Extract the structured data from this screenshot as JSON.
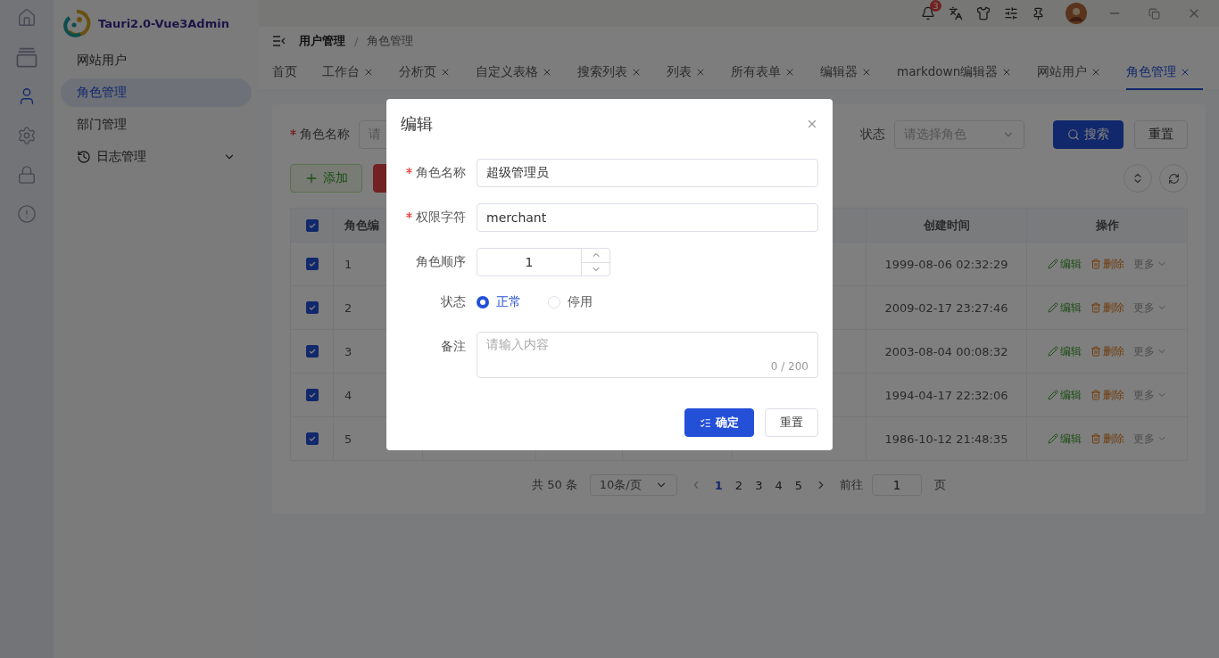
{
  "rail": {
    "items": [
      {
        "selected": false
      },
      {
        "selected": false
      },
      {
        "selected": true
      },
      {
        "selected": false
      },
      {
        "selected": false
      },
      {
        "selected": false
      }
    ]
  },
  "app_title": "Tauri2.0-Vue3Admin",
  "sidebar": {
    "items": [
      {
        "kind": "item",
        "label": "网站用户",
        "selected": false
      },
      {
        "kind": "item",
        "label": "角色管理",
        "selected": true
      },
      {
        "kind": "item",
        "label": "部门管理",
        "selected": false
      },
      {
        "kind": "group",
        "label": "日志管理",
        "selected": false,
        "expanded": false
      }
    ]
  },
  "topbar": {
    "notification_count": "3"
  },
  "breadcrumb": {
    "items": [
      "用户管理",
      "角色管理"
    ],
    "separator": "/"
  },
  "tabs": [
    {
      "label": "首页",
      "closable": false,
      "selected": false
    },
    {
      "label": "工作台",
      "closable": true,
      "selected": false
    },
    {
      "label": "分析页",
      "closable": true,
      "selected": false
    },
    {
      "label": "自定义表格",
      "closable": true,
      "selected": false
    },
    {
      "label": "搜索列表",
      "closable": true,
      "selected": false
    },
    {
      "label": "列表",
      "closable": true,
      "selected": false
    },
    {
      "label": "所有表单",
      "closable": true,
      "selected": false
    },
    {
      "label": "编辑器",
      "closable": true,
      "selected": false
    },
    {
      "label": "markdown编辑器",
      "closable": true,
      "selected": false
    },
    {
      "label": "网站用户",
      "closable": true,
      "selected": false
    },
    {
      "label": "角色管理",
      "closable": true,
      "selected": true
    }
  ],
  "search_form": {
    "name_field": {
      "label": "角色名称",
      "required": true,
      "placeholder": "请"
    },
    "status_field": {
      "label": "状态",
      "placeholder": "请选择角色"
    },
    "buttons": [
      {
        "label": "搜索",
        "kind": "primary"
      },
      {
        "label": "重置",
        "kind": "default"
      }
    ]
  },
  "toolbar": {
    "buttons": [
      {
        "label": "添加",
        "kind": "add"
      },
      {
        "kind": "delete"
      }
    ]
  },
  "table": {
    "select_all": true,
    "id_label": "角色编",
    "created_label": "创建时间",
    "actions_label": "操作",
    "rows": [
      {
        "checked": true,
        "id": "1",
        "created": "1999-08-06 02:32:29",
        "actions": [
          {
            "label": "编辑",
            "kind": "edit"
          },
          {
            "label": "删除",
            "kind": "delete"
          },
          {
            "label": "更多",
            "kind": "more"
          }
        ]
      },
      {
        "checked": true,
        "id": "2",
        "created": "2009-02-17 23:27:46",
        "actions": [
          {
            "label": "编辑",
            "kind": "edit"
          },
          {
            "label": "删除",
            "kind": "delete"
          },
          {
            "label": "更多",
            "kind": "more"
          }
        ]
      },
      {
        "checked": true,
        "id": "3",
        "created": "2003-08-04 00:08:32",
        "actions": [
          {
            "label": "编辑",
            "kind": "edit"
          },
          {
            "label": "删除",
            "kind": "delete"
          },
          {
            "label": "更多",
            "kind": "more"
          }
        ]
      },
      {
        "checked": true,
        "id": "4",
        "created": "1994-04-17 22:32:06",
        "actions": [
          {
            "label": "编辑",
            "kind": "edit"
          },
          {
            "label": "删除",
            "kind": "delete"
          },
          {
            "label": "更多",
            "kind": "more"
          }
        ]
      },
      {
        "checked": true,
        "id": "5",
        "created": "1986-10-12 21:48:35",
        "actions": [
          {
            "label": "编辑",
            "kind": "edit"
          },
          {
            "label": "删除",
            "kind": "delete"
          },
          {
            "label": "更多",
            "kind": "more"
          }
        ]
      }
    ]
  },
  "pagination": {
    "total": "共 50 条",
    "page_size": "10条/页",
    "pages": [
      {
        "label": "1",
        "selected": true
      },
      {
        "label": "2",
        "selected": false
      },
      {
        "label": "3",
        "selected": false
      },
      {
        "label": "4",
        "selected": false
      },
      {
        "label": "5",
        "selected": false
      }
    ],
    "goto_label": "前往",
    "goto_value": "1",
    "page_label": "页"
  },
  "dialog": {
    "title": "编辑",
    "fields": [
      {
        "kind": "text",
        "label": "角色名称",
        "required": true,
        "value": "超级管理员"
      },
      {
        "kind": "text",
        "label": "权限字符",
        "required": true,
        "value": "merchant"
      },
      {
        "kind": "number",
        "label": "角色顺序",
        "required": false,
        "value": "1"
      },
      {
        "kind": "radio",
        "label": "状态",
        "required": false,
        "options": [
          {
            "label": "正常",
            "selected": true
          },
          {
            "label": "停用",
            "selected": false
          }
        ]
      },
      {
        "kind": "textarea",
        "label": "备注",
        "required": false,
        "placeholder": "请输入内容",
        "counter": "0 / 200"
      }
    ],
    "buttons": [
      {
        "label": "确定",
        "kind": "primary"
      },
      {
        "label": "重置",
        "kind": "default"
      }
    ]
  }
}
